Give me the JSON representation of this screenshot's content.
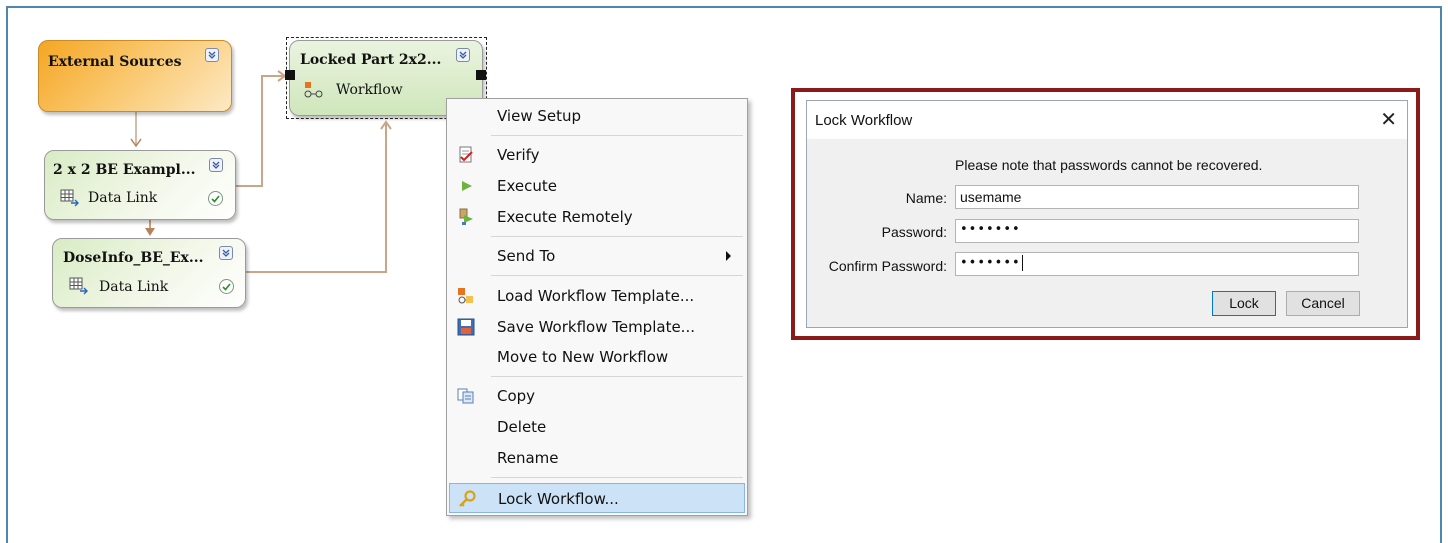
{
  "nodes": {
    "external": {
      "title": "External Sources"
    },
    "be_example": {
      "title": "2 x 2 BE Exampl...",
      "subtitle": "Data Link"
    },
    "doseinfo": {
      "title": "DoseInfo_BE_Ex...",
      "subtitle": "Data Link"
    },
    "locked": {
      "title": "Locked Part 2x2...",
      "subtitle": "Workflow"
    }
  },
  "context_menu": {
    "items": [
      {
        "label": "View Setup",
        "icon": ""
      },
      {
        "label": "Verify",
        "icon": "verify-icon"
      },
      {
        "label": "Execute",
        "icon": "play-icon"
      },
      {
        "label": "Execute Remotely",
        "icon": "execute-remotely-icon"
      },
      {
        "label": "Send To",
        "icon": "",
        "submenu": true
      },
      {
        "label": "Load Workflow Template...",
        "icon": "load-template-icon"
      },
      {
        "label": "Save Workflow Template...",
        "icon": "save-template-icon"
      },
      {
        "label": "Move to New Workflow",
        "icon": ""
      },
      {
        "label": "Copy",
        "icon": "copy-icon"
      },
      {
        "label": "Delete",
        "icon": ""
      },
      {
        "label": "Rename",
        "icon": ""
      },
      {
        "label": "Lock Workflow...",
        "icon": "key-icon",
        "highlighted": true
      }
    ]
  },
  "dialog": {
    "title": "Lock Workflow",
    "close": "✕",
    "note": "Please note that passwords cannot be recovered.",
    "name_label": "Name:",
    "name_value": "usemame",
    "password_label": "Password:",
    "password_value": "•••••••",
    "confirm_label": "Confirm Password:",
    "confirm_value": "•••••••",
    "lock_button": "Lock",
    "cancel_button": "Cancel"
  },
  "colors": {
    "frame_border": "#4f86b0",
    "dialog_highlight_border": "#8b1a1a",
    "connector": "#b5835a",
    "menu_highlight": "#cce3f7"
  }
}
